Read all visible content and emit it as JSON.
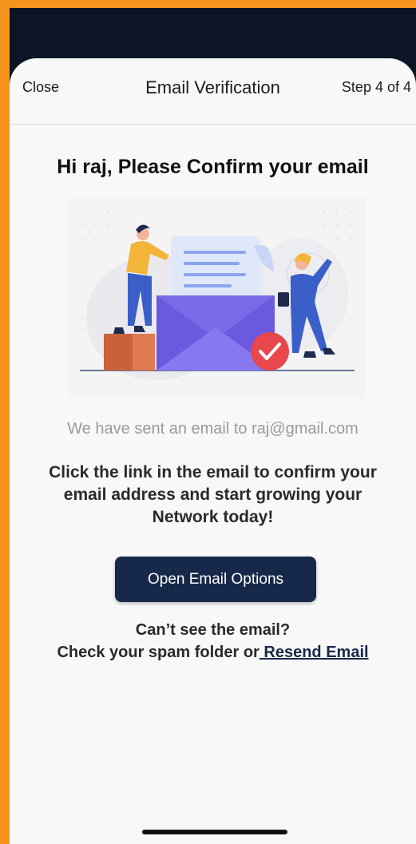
{
  "nav": {
    "close_label": "Close",
    "title": "Email Verification",
    "step": "Step 4 of 4"
  },
  "main": {
    "headline": "Hi raj, Please Confirm your email",
    "sent_message": "We have sent an email to raj@gmail.com",
    "instruction": "Click the link in the email to confirm your email address and start growing your Network today!",
    "open_email_button": "Open Email Options",
    "help_question": "Can’t see the email?",
    "help_text": "Check your spam folder or",
    "resend_link": " Resend Email"
  },
  "colors": {
    "frame_border": "#f7941d",
    "status_bar": "#0b1526",
    "sheet": "#f8f8f8",
    "primary": "#17294a",
    "envelope": "#7b6ae8",
    "check_badge": "#e8474c"
  },
  "icons": {
    "illustration": "email-confirmation-illustration",
    "check": "check-badge-icon"
  }
}
